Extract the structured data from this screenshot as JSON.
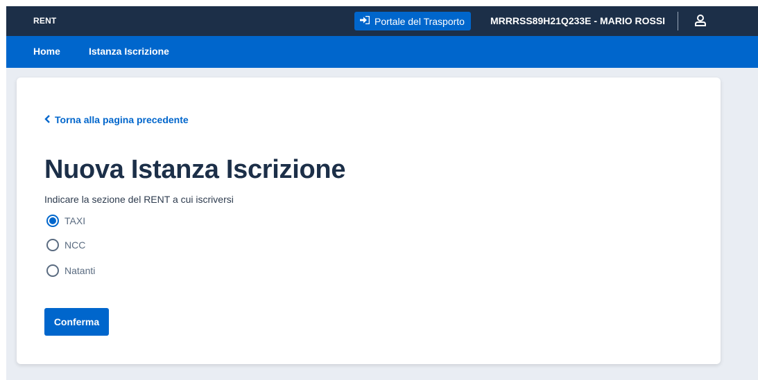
{
  "header": {
    "app_title": "RENT",
    "portal_button_label": "Portale del Trasporto",
    "user_label": "MRRRSS89H21Q233E - MARIO ROSSI"
  },
  "nav": {
    "items": [
      {
        "label": "Home"
      },
      {
        "label": "Istanza Iscrizione"
      }
    ]
  },
  "main": {
    "back_link": "Torna alla pagina precedente",
    "title": "Nuova Istanza Iscrizione",
    "instruction": "Indicare la sezione del RENT a cui iscriversi",
    "options": [
      {
        "label": "TAXI",
        "selected": true
      },
      {
        "label": "NCC",
        "selected": false
      },
      {
        "label": "Natanti",
        "selected": false
      }
    ],
    "confirm_label": "Conferma"
  },
  "icons": {
    "portal": "sign-in-icon",
    "user": "user-icon",
    "back": "chevron-left-icon"
  },
  "colors": {
    "header_bg": "#1c2f48",
    "accent": "#0066cc",
    "page_bg": "#e9edf3"
  }
}
